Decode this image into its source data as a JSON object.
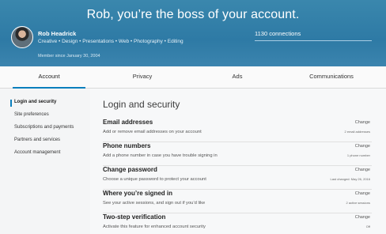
{
  "hero": {
    "title": "Rob, you’re the boss of your account.",
    "name": "Rob Headrick",
    "headline": "Creative • Design • Presentations • Web • Photography • Editing",
    "member_since": "Member since January 30, 2004",
    "connections": "1130 connections"
  },
  "tabs": [
    {
      "label": "Account",
      "active": true
    },
    {
      "label": "Privacy",
      "active": false
    },
    {
      "label": "Ads",
      "active": false
    },
    {
      "label": "Communications",
      "active": false
    }
  ],
  "sidebar": {
    "items": [
      {
        "label": "Login and security",
        "active": true
      },
      {
        "label": "Site preferences"
      },
      {
        "label": "Subscriptions and payments"
      },
      {
        "label": "Partners and services"
      },
      {
        "label": "Account management"
      }
    ]
  },
  "main": {
    "section_title": "Login and security",
    "settings": [
      {
        "title": "Email addresses",
        "desc": "Add or remove email addresses on your account",
        "action": "Change",
        "status": "2 email addresses"
      },
      {
        "title": "Phone numbers",
        "desc": "Add a phone number in case you have trouble signing in",
        "action": "Change",
        "status": "1 phone number"
      },
      {
        "title": "Change password",
        "desc": "Choose a unique password to protect your account",
        "action": "Change",
        "status": "Last changed: May 26, 2016"
      },
      {
        "title": "Where you’re signed in",
        "desc": "See your active sessions, and sign out if you’d like",
        "action": "Change",
        "status": "2 active sessions"
      },
      {
        "title": "Two-step verification",
        "desc": "Activate this feature for enhanced account security",
        "action": "Change",
        "status": "Off"
      }
    ]
  },
  "colors": {
    "hero": "#2e7aa5",
    "accent": "#0a7fbd"
  }
}
